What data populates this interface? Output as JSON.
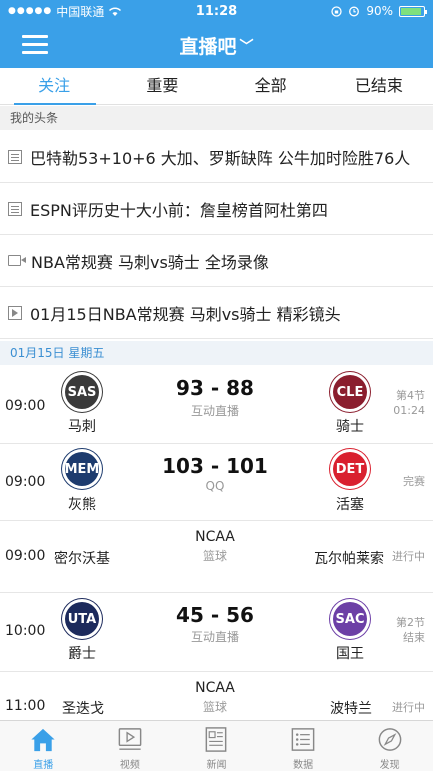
{
  "status_bar": {
    "carrier": "中国联通",
    "time": "11:28",
    "battery": "90%",
    "battery_level": 0.9
  },
  "nav": {
    "title": "直播吧"
  },
  "tabs": [
    "关注",
    "重要",
    "全部",
    "已结束"
  ],
  "headlines": {
    "section_title": "我的头条",
    "items": [
      {
        "icon": "article-icon",
        "text": "巴特勒53+10+6 大加、罗斯缺阵 公牛加时险胜76人"
      },
      {
        "icon": "article-icon",
        "text": "ESPN评历史十大小前：詹皇榜首阿杜第四"
      },
      {
        "icon": "video-icon",
        "text": "NBA常规赛 马刺vs骑士 全场录像"
      },
      {
        "icon": "play-icon",
        "text": "01月15日NBA常规赛 马刺vs骑士 精彩镜头"
      }
    ]
  },
  "schedule": {
    "date_header": "01月15日 星期五",
    "matches": [
      {
        "time": "09:00",
        "home": "马刺",
        "home_abbr": "SAS",
        "home_color": "#3a3a3a",
        "away": "骑士",
        "away_abbr": "CLE",
        "away_color": "#8b1e2e",
        "score": "93 - 88",
        "sub": "互动直播",
        "status_line1": "第4节",
        "status_line2": "01:24"
      },
      {
        "time": "09:00",
        "home": "灰熊",
        "home_abbr": "MEM",
        "home_color": "#1d3b6e",
        "away": "活塞",
        "away_abbr": "DET",
        "away_color": "#d9202f",
        "score": "103 - 101",
        "sub": "QQ",
        "status_line1": "完赛",
        "status_line2": ""
      },
      {
        "time": "09:00",
        "home": "密尔沃基",
        "away": "瓦尔帕莱索",
        "league": "NCAA",
        "sub": "篮球",
        "status_line1": "进行中"
      },
      {
        "time": "10:00",
        "home": "爵士",
        "home_abbr": "UTA",
        "home_color": "#1c2a5c",
        "away": "国王",
        "away_abbr": "SAC",
        "away_color": "#6c3fa6",
        "score": "45 - 56",
        "sub": "互动直播",
        "status_line1": "第2节",
        "status_line2": "结束"
      },
      {
        "time": "11:00",
        "home": "圣迭戈",
        "away": "波特兰",
        "league": "NCAA",
        "sub": "篮球",
        "status_line1": "进行中"
      }
    ]
  },
  "bottom_tabs": [
    {
      "label": "直播",
      "icon": "home-icon"
    },
    {
      "label": "视频",
      "icon": "video-player-icon"
    },
    {
      "label": "新闻",
      "icon": "news-icon"
    },
    {
      "label": "数据",
      "icon": "data-list-icon"
    },
    {
      "label": "发现",
      "icon": "compass-icon"
    }
  ],
  "colors": {
    "accent": "#3aa0e8"
  }
}
